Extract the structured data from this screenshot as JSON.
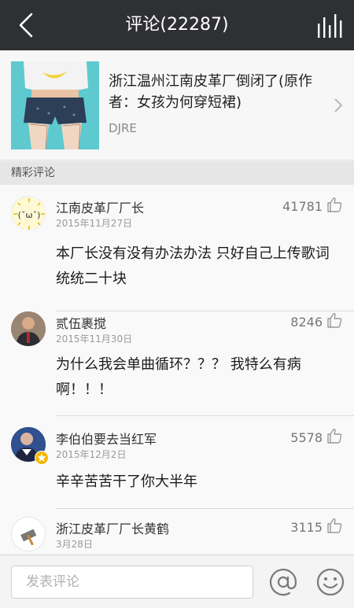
{
  "header": {
    "title": "评论(22287)"
  },
  "song": {
    "name": "浙江温州江南皮革厂倒闭了(原作者：女孩为何穿短裙)",
    "author": "DJRE"
  },
  "section": {
    "title": "精彩评论"
  },
  "comments": [
    {
      "user": "江南皮革厂厂长",
      "date": "2015年11月27日",
      "likes": "41781",
      "text": "本厂长没有没有办法办法 只好自己上传歌词 统统二十块",
      "avatar_text": "(ˇωˇ)"
    },
    {
      "user": "贰伍裹搅",
      "date": "2015年11月30日",
      "likes": "8246",
      "text": "为什么我会单曲循环？？？ 我特么有病啊！！！"
    },
    {
      "user": "李伯伯要去当红军",
      "date": "2015年12月2日",
      "likes": "5578",
      "text": "辛辛苦苦干了你大半年"
    },
    {
      "user": "浙江皮革厂厂长黄鹤",
      "date": "3月28日",
      "likes": "3115",
      "text": ""
    }
  ],
  "footer": {
    "input_placeholder": "发表评论"
  },
  "colors": {
    "topbar": "#2f3033",
    "cover_bg": "#5ec9cf",
    "badge": "#f2b600"
  }
}
